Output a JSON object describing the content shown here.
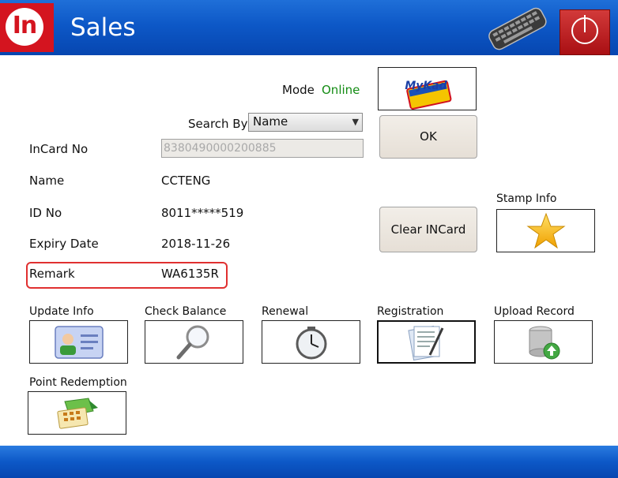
{
  "header": {
    "logo_text": "In",
    "title": "Sales"
  },
  "mode": {
    "label": "Mode",
    "value": "Online",
    "value_color": "#148c14"
  },
  "mykad_logo_text": "MyKad",
  "search": {
    "label": "Search By",
    "selected": "Name"
  },
  "buttons": {
    "ok": "OK",
    "clear": "Clear INCard"
  },
  "fields": [
    {
      "label": "InCard No",
      "value": "8380490000200885"
    },
    {
      "label": "Name",
      "value": "CCTENG"
    },
    {
      "label": "ID No",
      "value": "8011*****519"
    },
    {
      "label": "Expiry Date",
      "value": "2018-11-26"
    },
    {
      "label": "Remark",
      "value": "WA6135R"
    }
  ],
  "stamp": {
    "label": "Stamp Info",
    "icon": "star-icon"
  },
  "actions": [
    {
      "label": "Update Info",
      "icon": "user-card-icon"
    },
    {
      "label": "Check Balance",
      "icon": "magnifier-icon"
    },
    {
      "label": "Renewal",
      "icon": "clock-icon"
    },
    {
      "label": "Registration",
      "icon": "document-pen-icon"
    },
    {
      "label": "Upload Record",
      "icon": "database-upload-icon"
    },
    {
      "label": "Point Redemption",
      "icon": "calculator-arrow-icon"
    }
  ],
  "accent": {
    "header": "#0d58c7",
    "logo": "#d4141f",
    "highlight": "#e03030"
  }
}
